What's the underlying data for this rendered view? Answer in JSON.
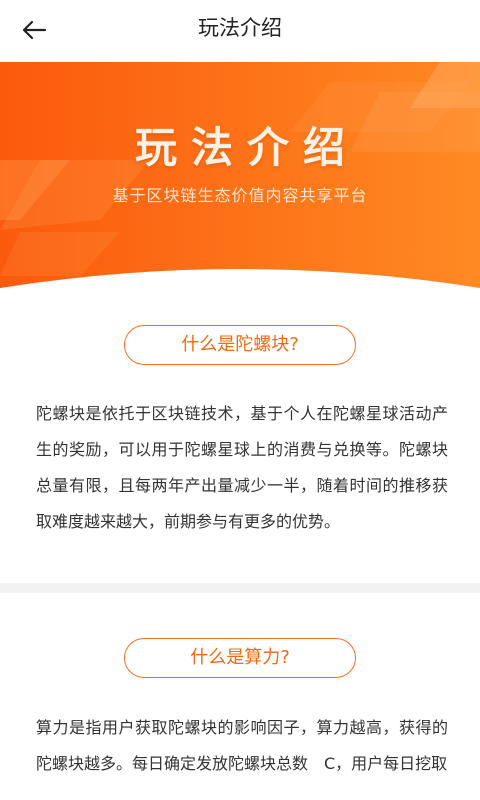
{
  "header": {
    "title": "玩法介绍",
    "back_icon": "arrow-left-icon"
  },
  "banner": {
    "title": "玩法介绍",
    "subtitle": "基于区块链生态价值内容共享平台",
    "colors": {
      "start": "#fb5a0c",
      "end": "#ff8c26"
    }
  },
  "sections": [
    {
      "heading": "什么是陀螺块?",
      "body": "陀螺块是依托于区块链技术，基于个人在陀螺星球活动产生的奖励，可以用于陀螺星球上的消费与兑换等。陀螺块总量有限，且每两年产出量减少一半，随着时间的推移获取难度越来越大，前期参与有更多的优势。"
    },
    {
      "heading": "什么是算力?",
      "body": "算力是指用户获取陀螺块的影响因子，算力越高，获得的陀螺块越多。每日确定发放陀螺块总数　C，用户每日挖取"
    }
  ],
  "theme": {
    "accent": "#f06a14"
  }
}
